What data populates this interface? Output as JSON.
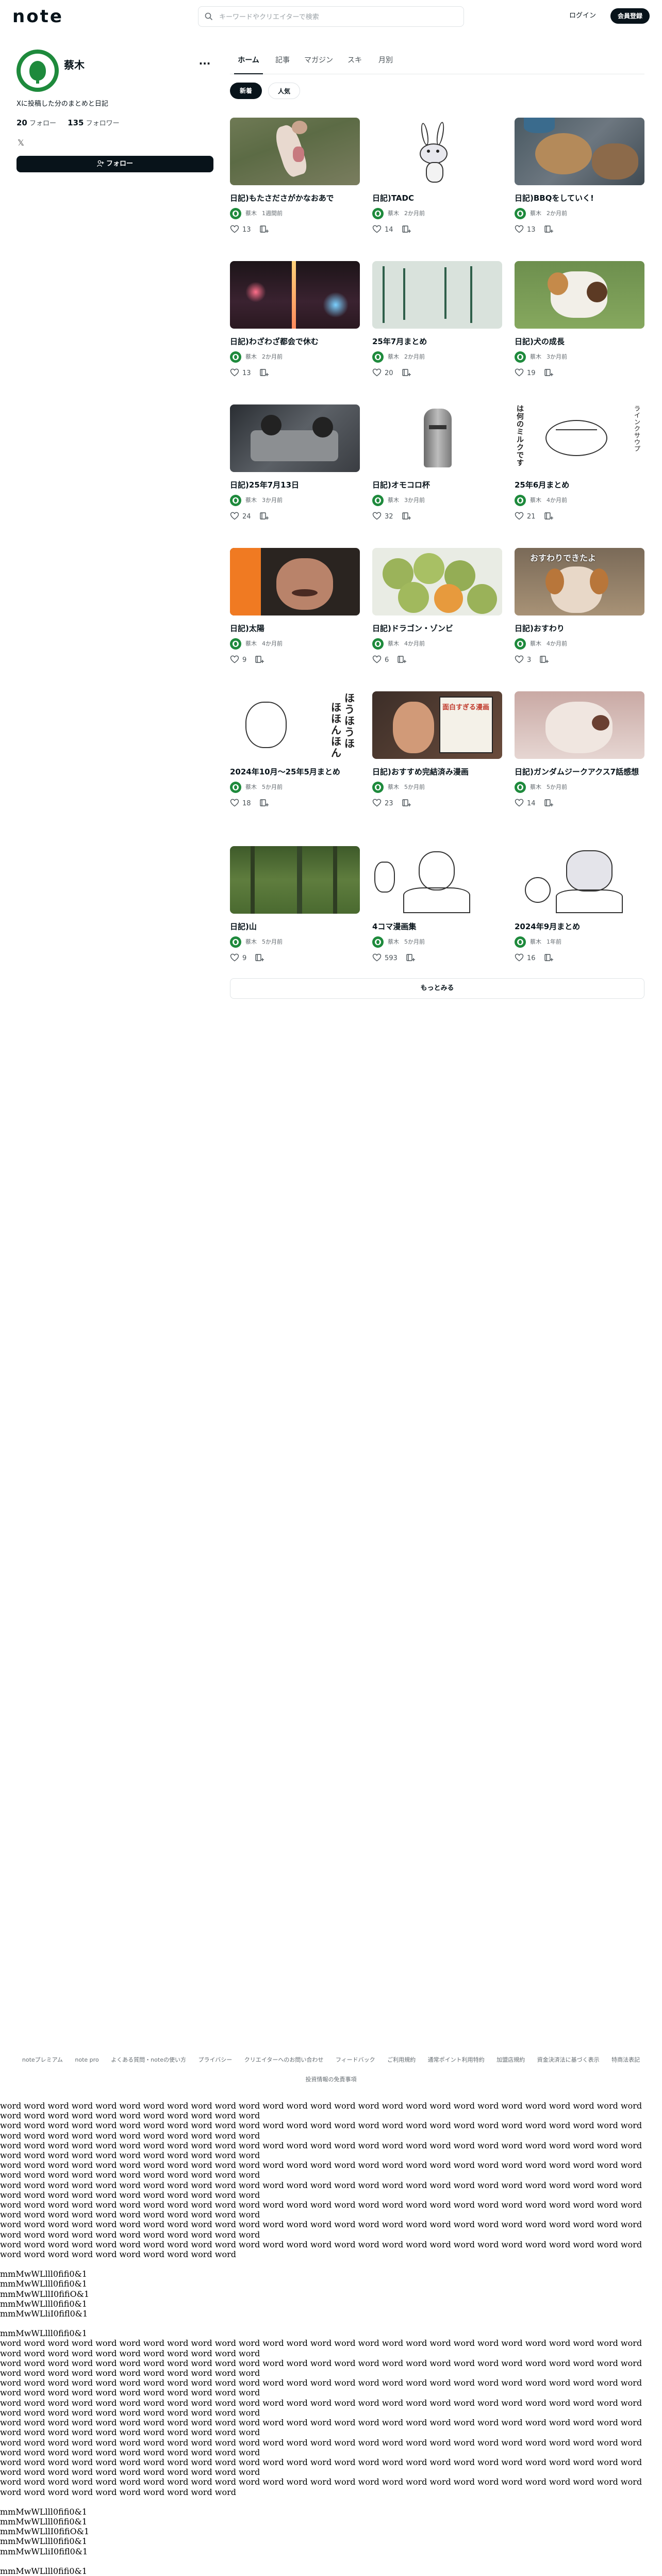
{
  "header": {
    "logo": "note",
    "search_placeholder": "キーワードやクリエイターで検索",
    "login": "ログイン",
    "signup": "会員登録"
  },
  "profile": {
    "name": "蔡木",
    "bio": "Xに投稿した分のまとめと日記",
    "follow_count": "20",
    "follow_label": "フォロー",
    "follower_count": "135",
    "follower_label": "フォロワー",
    "menu_icon": "more-icon",
    "x_icon": "x-logo-icon",
    "follow_button": "フォロー"
  },
  "tabs": [
    {
      "label": "ホーム"
    },
    {
      "label": "記事"
    },
    {
      "label": "マガジン"
    },
    {
      "label": "スキ"
    },
    {
      "label": "月別"
    }
  ],
  "filters": {
    "new": "新着",
    "popular": "人気"
  },
  "cards": [
    {
      "title": "日記)もたさださがかなおあで",
      "author": "蔡木",
      "time": "1週間前",
      "likes": "13"
    },
    {
      "title": "日記)TADC",
      "author": "蔡木",
      "time": "2か月前",
      "likes": "14"
    },
    {
      "title": "日記)BBQをしていく!",
      "author": "蔡木",
      "time": "2か月前",
      "likes": "13"
    },
    {
      "title": "日記)わざわざ都会で休む",
      "author": "蔡木",
      "time": "2か月前",
      "likes": "13"
    },
    {
      "title": "25年7月まとめ",
      "author": "蔡木",
      "time": "2か月前",
      "likes": "20"
    },
    {
      "title": "日記)犬の成長",
      "author": "蔡木",
      "time": "3か月前",
      "likes": "19"
    },
    {
      "title": "日記)25年7月13日",
      "author": "蔡木",
      "time": "3か月前",
      "likes": "24"
    },
    {
      "title": "日記)オモコロ杯",
      "author": "蔡木",
      "time": "3か月前",
      "likes": "32"
    },
    {
      "title": "25年6月まとめ",
      "author": "蔡木",
      "time": "4か月前",
      "likes": "21"
    },
    {
      "title": "日記)太陽",
      "author": "蔡木",
      "time": "4か月前",
      "likes": "9"
    },
    {
      "title": "日記)ドラゴン・ゾンビ",
      "author": "蔡木",
      "time": "4か月前",
      "likes": "6"
    },
    {
      "title": "日記)おすわり",
      "author": "蔡木",
      "time": "4か月前",
      "likes": "3"
    },
    {
      "title": "2024年10月〜25年5月まとめ",
      "author": "蔡木",
      "time": "5か月前",
      "likes": "18"
    },
    {
      "title": "日記)おすすめ完結済み漫画",
      "author": "蔡木",
      "time": "5か月前",
      "likes": "23"
    },
    {
      "title": "日記)ガンダムジークアクス7話感想",
      "author": "蔡木",
      "time": "5か月前",
      "likes": "14"
    },
    {
      "title": "日記)山",
      "author": "蔡木",
      "time": "5か月前",
      "likes": "9"
    },
    {
      "title": "4コマ漫画集",
      "author": "蔡木",
      "time": "5か月前",
      "likes": "593"
    },
    {
      "title": "2024年9月まとめ",
      "author": "蔡木",
      "time": "1年前",
      "likes": "16"
    }
  ],
  "thumb_text": {
    "t6": "は何のミルクです",
    "t6b": "ラインクサウプ",
    "t12": "おすわりできたよ",
    "t13a": "ほうほうほ",
    "t13b": "ほほんほん",
    "t14": "面白すぎる漫画"
  },
  "more_button": "もっとみる",
  "footer": {
    "links": [
      "noteプレミアム",
      "note pro",
      "よくある質問・noteの使い方",
      "プライバシー",
      "クリエイターへのお問い合わせ",
      "フィードバック",
      "ご利用規約",
      "通常ポイント利用特約",
      "加盟店規約",
      "資金決済法に基づく表示",
      "特商法表記"
    ],
    "bottom_link": "投資情報の免責事項"
  },
  "filler": {
    "word_line": "word word word word word word word word word word word word word word word word word word word word word word word word word word word word word word word word word word word word word word",
    "word_last": "word word word word word word word word word word word word word word word word word word word word word word word word word word word word word word word word word word word word word",
    "mono_1": "mmMwWLlll0fifi0&1",
    "mono_2": "mmMwWLlll0fifi0&1",
    "mono_3": "mmMwWLllI0fifiO&1",
    "mono_4": "mmMwWLlll0fifi0&1",
    "mono_5": "mmMwWLliI0fifl0&1",
    "mono_6": "mmMwWLlll0fifi0&1"
  }
}
